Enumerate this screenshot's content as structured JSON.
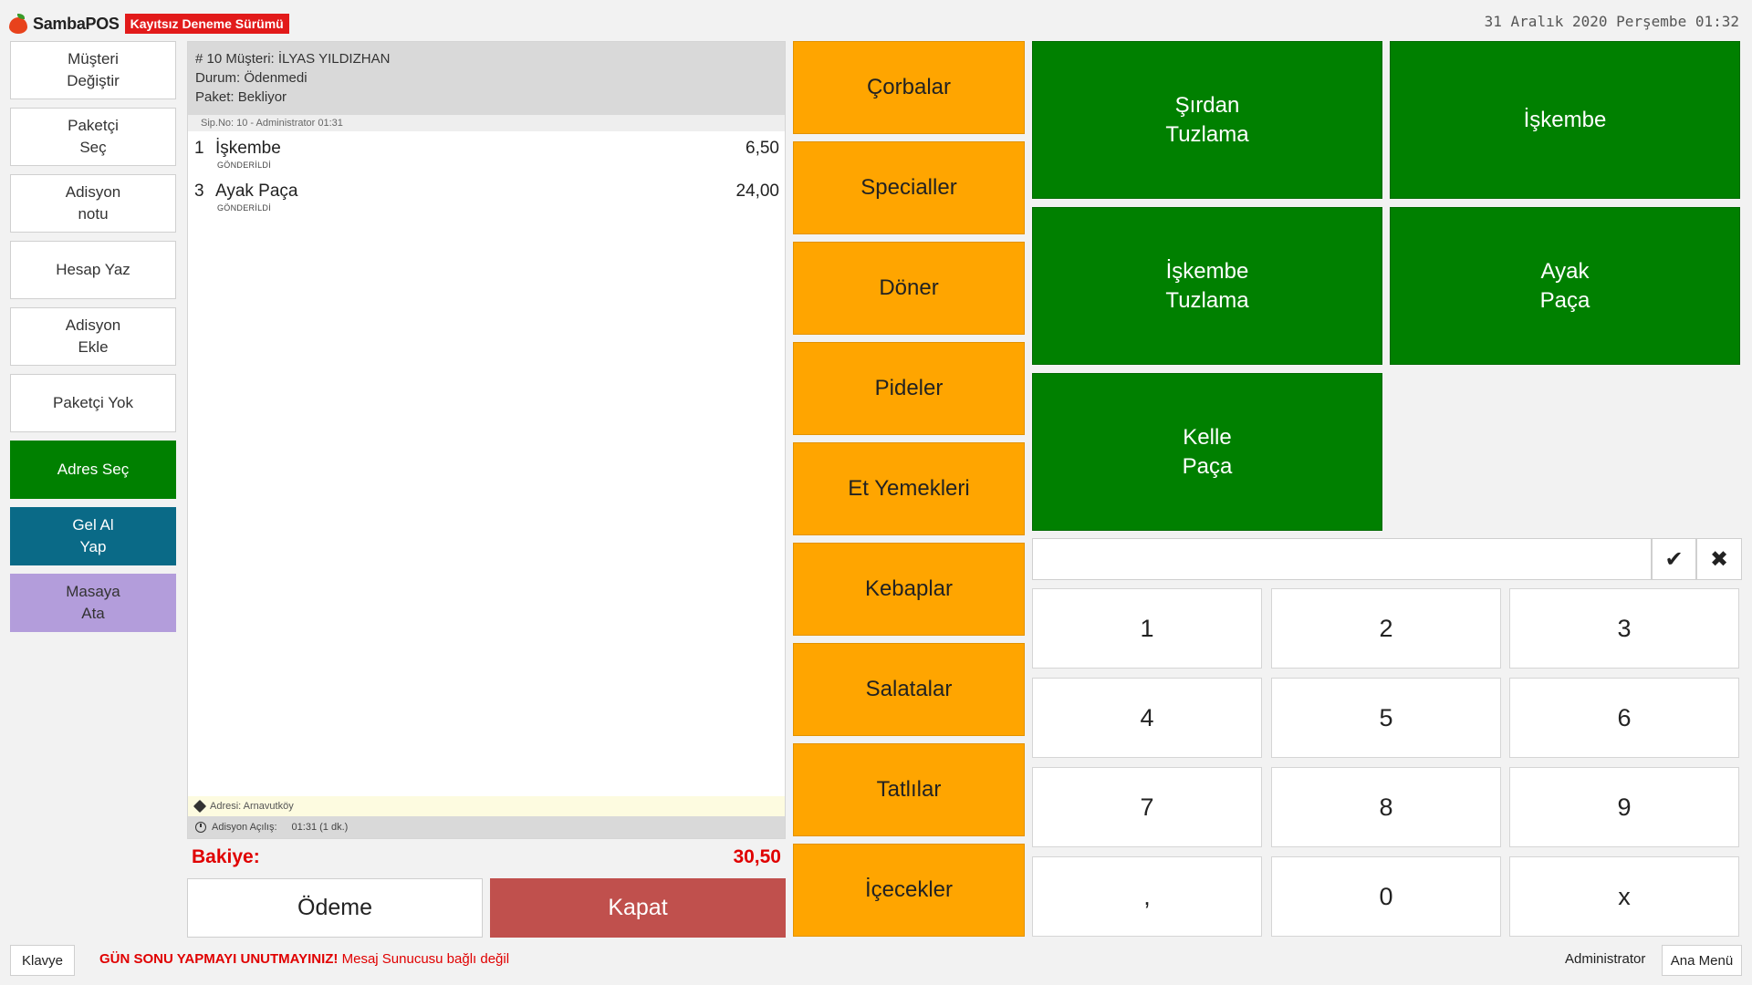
{
  "header": {
    "app_name": "SambaPOS",
    "trial_badge": "Kayıtsız Deneme Sürümü",
    "datetime": "31 Aralık 2020 Perşembe 01:32"
  },
  "actions": [
    {
      "label": "Müşteri\nDeğiştir",
      "color": "#ffffff",
      "text_color": "#333333"
    },
    {
      "label": "Paketçi\nSeç",
      "color": "#ffffff",
      "text_color": "#333333"
    },
    {
      "label": "Adisyon\nnotu",
      "color": "#ffffff",
      "text_color": "#333333"
    },
    {
      "label": "Hesap Yaz",
      "color": "#ffffff",
      "text_color": "#333333"
    },
    {
      "label": "Adisyon\nEkle",
      "color": "#ffffff",
      "text_color": "#333333"
    },
    {
      "label": "Paketçi Yok",
      "color": "#ffffff",
      "text_color": "#333333"
    },
    {
      "label": "Adres Seç",
      "color": "#008000",
      "text_color": "#ffffff"
    },
    {
      "label": "Gel Al\nYap",
      "color": "#0a6a87",
      "text_color": "#ffffff"
    },
    {
      "label": "Masaya\nAta",
      "color": "#b39ddb",
      "text_color": "#333333"
    }
  ],
  "ticket": {
    "customer_line": "# 10 Müşteri: İLYAS YILDIZHAN",
    "status_line": "Durum: Ödenmedi",
    "package_line": "Paket: Bekliyor",
    "sip_line": "Sip.No: 10 - Administrator 01:31",
    "orders": [
      {
        "qty": "1",
        "name": "İşkembe",
        "status": "GÖNDERİLDİ",
        "price": "6,50"
      },
      {
        "qty": "3",
        "name": "Ayak Paça",
        "status": "GÖNDERİLDİ",
        "price": "24,00"
      }
    ],
    "address": "Adresi: Arnavutköy",
    "opened_label": "Adisyon Açılış:",
    "opened_value": "01:31 (1 dk.)",
    "balance_label": "Bakiye:",
    "balance_value": "30,50",
    "pay_label": "Ödeme",
    "close_label": "Kapat"
  },
  "categories": [
    "Çorbalar",
    "Specialler",
    "Döner",
    "Pideler",
    "Et Yemekleri",
    "Kebaplar",
    "Salatalar",
    "Tatlılar",
    "İçecekler"
  ],
  "products": [
    "Şırdan\nTuzlama",
    "İşkembe",
    "İşkembe\nTuzlama",
    "Ayak\nPaça",
    "Kelle\nPaça"
  ],
  "input": {
    "value": "",
    "ok_icon": "✔",
    "cancel_icon": "✖"
  },
  "numpad": [
    "1",
    "2",
    "3",
    "4",
    "5",
    "6",
    "7",
    "8",
    "9",
    ",",
    "0",
    "x"
  ],
  "footer": {
    "keyboard_label": "Klavye",
    "warning": "GÜN SONU YAPMAYI UNUTMAYINIZ!",
    "status": "Mesaj Sunucusu bağlı değil",
    "user": "Administrator",
    "main_menu_label": "Ana Menü"
  }
}
